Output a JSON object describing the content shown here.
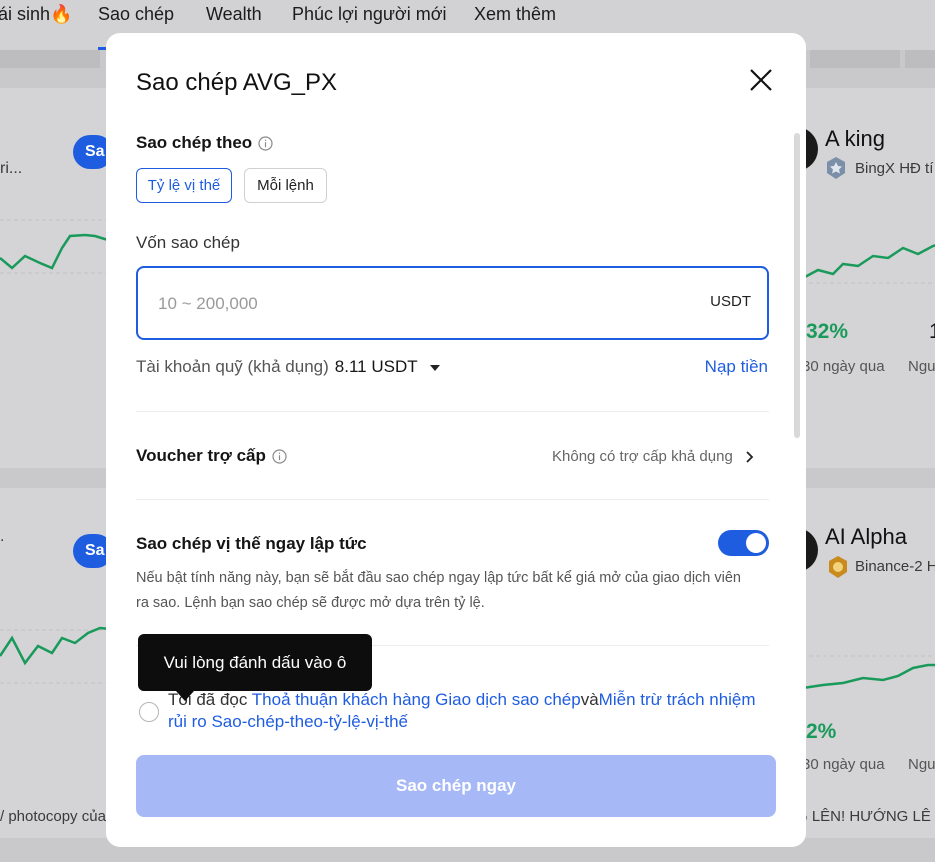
{
  "nav": {
    "items": [
      "ái sinh🔥",
      "Sao chép",
      "Wealth",
      "Phúc lợi người mới",
      "Xem thêm"
    ]
  },
  "background": {
    "left_cards": {
      "card1_text": "ri...",
      "card1_pill": "Sa",
      "card2_text": ".",
      "card2_pill": "Sa",
      "bottom_text": "/ photocopy của"
    },
    "right_cards": {
      "card1_name": "A king",
      "card1_exchange": "BingX HĐ tí",
      "card1_percent": "32%",
      "card1_period": "30 ngày qua",
      "card1_extra": "Ngu",
      "card1_digit": "1",
      "card2_name": "AI Alpha",
      "card2_exchange": "Binance-2 H",
      "card2_percent": "2%",
      "card2_period": "30 ngày qua",
      "card2_extra": "Ngu",
      "bottom_text": "G LÊN! HƯỚNG LÊ"
    }
  },
  "modal": {
    "title": "Sao chép AVG_PX",
    "copy_mode": {
      "label": "Sao chép theo",
      "tabs": [
        "Tỷ lệ vị thế",
        "Mỗi lệnh"
      ],
      "selected": "Tỷ lệ vị thế"
    },
    "capital": {
      "label": "Vốn sao chép",
      "placeholder": "10 ~ 200,000",
      "value": "",
      "unit": "USDT"
    },
    "balance": {
      "label": "Tài khoản quỹ (khả dụng)",
      "value": "8.11 USDT",
      "deposit_link": "Nạp tiền"
    },
    "voucher": {
      "label": "Voucher trợ cấp",
      "value": "Không có trợ cấp khả dụng"
    },
    "instant_copy": {
      "label": "Sao chép vị thế ngay lập tức",
      "enabled": true,
      "description": "Nếu bật tính năng này, bạn sẽ bắt đầu sao chép ngay lập tức bất kể giá mở của giao dịch viên ra sao. Lệnh bạn sao chép sẽ được mở dựa trên tỷ lệ."
    },
    "tooltip": "Vui lòng đánh dấu vào ô",
    "agreement": {
      "prefix": "Tôi đã đọc ",
      "link1": "Thoả thuận khách hàng Giao dịch sao chép",
      "joiner": "và",
      "link2": "Miễn trừ trách nhiệm rủi ro Sao-chép-theo-tỷ-lệ-vị-thế",
      "checked": false
    },
    "submit_label": "Sao chép ngay"
  },
  "colors": {
    "accent": "#1f5de0",
    "button_disabled": "#a6b9f6",
    "chart_line": "#1a9a5a"
  },
  "icons": [
    "close-icon",
    "info-icon",
    "chevron-right-icon",
    "caret-down-icon",
    "badge-icon",
    "fire-icon"
  ]
}
